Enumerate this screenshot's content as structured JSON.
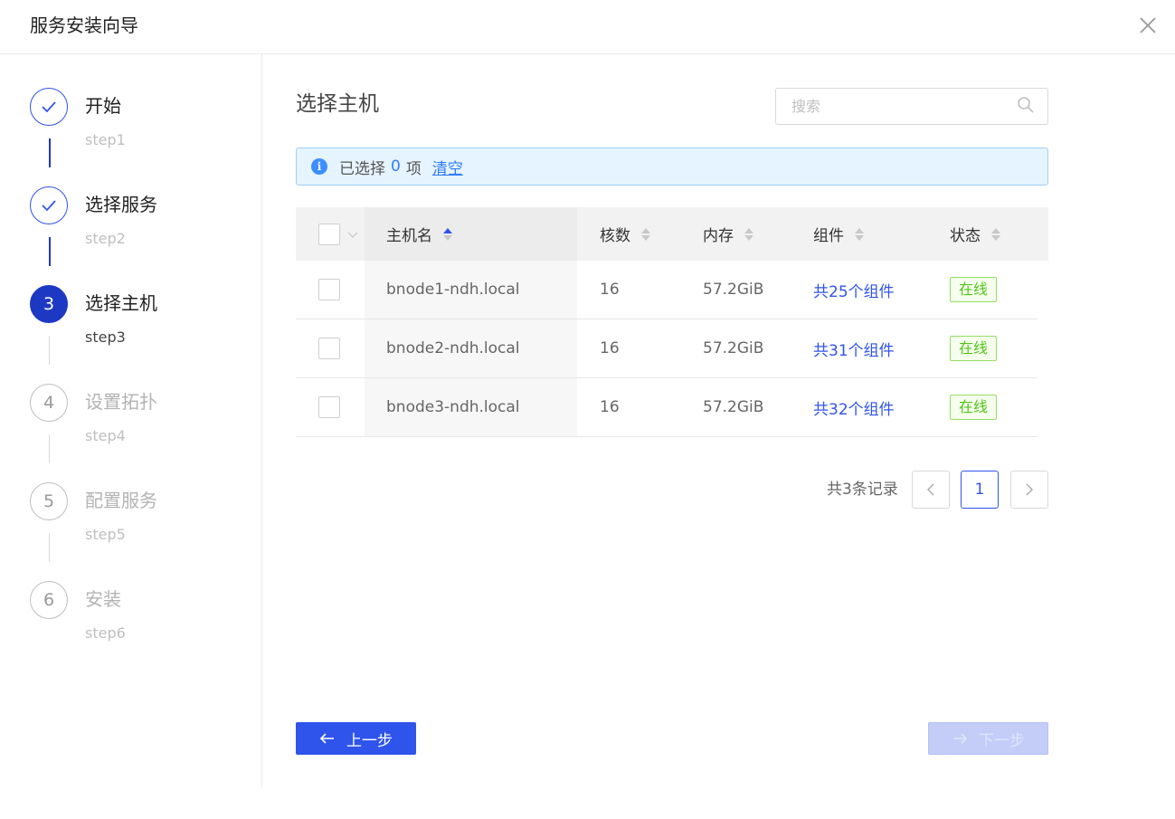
{
  "dialog": {
    "title": "服务安装向导",
    "close_icon": "close-icon"
  },
  "steps": [
    {
      "index": "1",
      "title": "开始",
      "sub": "step1",
      "state": "done"
    },
    {
      "index": "2",
      "title": "选择服务",
      "sub": "step2",
      "state": "done"
    },
    {
      "index": "3",
      "title": "选择主机",
      "sub": "step3",
      "state": "active"
    },
    {
      "index": "4",
      "title": "设置拓扑",
      "sub": "step4",
      "state": "wait"
    },
    {
      "index": "5",
      "title": "配置服务",
      "sub": "step5",
      "state": "wait"
    },
    {
      "index": "6",
      "title": "安装",
      "sub": "step6",
      "state": "wait"
    }
  ],
  "main": {
    "title": "选择主机",
    "search": {
      "placeholder": "搜索",
      "value": ""
    },
    "alert": {
      "prefix": "已选择",
      "count": "0",
      "unit": "项",
      "clear": "清空"
    },
    "table": {
      "columns": [
        {
          "key": "host",
          "label": "主机名",
          "sort": "asc"
        },
        {
          "key": "cores",
          "label": "核数",
          "sort": "none"
        },
        {
          "key": "memory",
          "label": "内存",
          "sort": "none"
        },
        {
          "key": "components",
          "label": "组件",
          "sort": "none"
        },
        {
          "key": "status",
          "label": "状态",
          "sort": "none"
        }
      ],
      "rows": [
        {
          "host": "bnode1-ndh.local",
          "cores": "16",
          "memory": "57.2GiB",
          "components": "共25个组件",
          "status": "在线"
        },
        {
          "host": "bnode2-ndh.local",
          "cores": "16",
          "memory": "57.2GiB",
          "components": "共31个组件",
          "status": "在线"
        },
        {
          "host": "bnode3-ndh.local",
          "cores": "16",
          "memory": "57.2GiB",
          "components": "共32个组件",
          "status": "在线"
        }
      ]
    },
    "pagination": {
      "total": "共3条记录",
      "current": "1"
    }
  },
  "footer": {
    "prev_label": "上一步",
    "next_label": "下一步"
  },
  "colors": {
    "primary": "#2f54eb",
    "active_step": "#1d39c4",
    "online_tag": "#52c41a",
    "alert_bg": "#e6f4ff"
  }
}
